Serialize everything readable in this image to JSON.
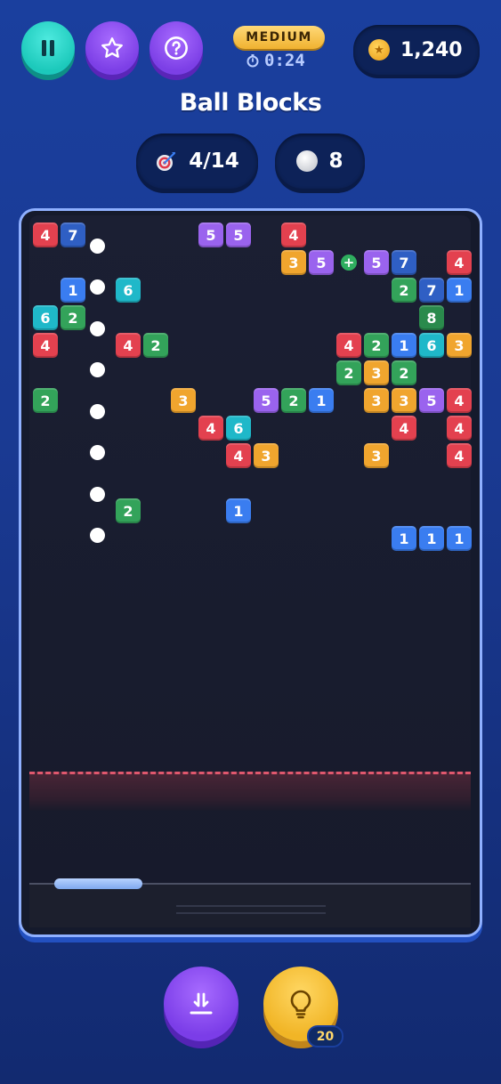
{
  "header": {
    "difficulty": "MEDIUM",
    "timer": "0:24",
    "coins": "1,240"
  },
  "title": "Ball Blocks",
  "stats": {
    "level": "4/14",
    "balls": "8"
  },
  "hint_count": "20",
  "icons": {
    "pause": "pause-icon",
    "star": "star-icon",
    "help": "question-icon",
    "stopwatch": "stopwatch-icon",
    "coin": "coin-icon",
    "target": "target-icon",
    "ball": "ball-icon",
    "drop": "drop-down-icon",
    "hint": "lightbulb-icon"
  },
  "colors": {
    "red": "#e3414f",
    "blue_dark": "#2f5fc4",
    "blue": "#3a7df0",
    "purple": "#9a63ee",
    "orange": "#f0a52e",
    "green": "#33a35a",
    "green_dark": "#2a8a4c",
    "cyan": "#1fb8c9",
    "accent_teal": "#1cc9bb",
    "accent_purple": "#7c3fe6",
    "accent_gold": "#f1b526"
  },
  "board": {
    "columns": 16,
    "blocks": [
      {
        "col": 0,
        "row": 0,
        "v": "4",
        "c": "red"
      },
      {
        "col": 1,
        "row": 0,
        "v": "7",
        "c": "blue_dark"
      },
      {
        "col": 6,
        "row": 0,
        "v": "5",
        "c": "purple"
      },
      {
        "col": 7,
        "row": 0,
        "v": "5",
        "c": "purple"
      },
      {
        "col": 9,
        "row": 0,
        "v": "4",
        "c": "red"
      },
      {
        "col": 9,
        "row": 1,
        "v": "3",
        "c": "orange"
      },
      {
        "col": 10,
        "row": 1,
        "v": "5",
        "c": "purple"
      },
      {
        "col": 12,
        "row": 1,
        "v": "5",
        "c": "purple"
      },
      {
        "col": 13,
        "row": 1,
        "v": "7",
        "c": "blue_dark"
      },
      {
        "col": 15,
        "row": 1,
        "v": "4",
        "c": "red"
      },
      {
        "col": 1,
        "row": 2,
        "v": "1",
        "c": "blue"
      },
      {
        "col": 3,
        "row": 2,
        "v": "6",
        "c": "cyan"
      },
      {
        "col": 13,
        "row": 2,
        "v": "2",
        "c": "green"
      },
      {
        "col": 14,
        "row": 2,
        "v": "7",
        "c": "blue_dark"
      },
      {
        "col": 15,
        "row": 2,
        "v": "1",
        "c": "blue"
      },
      {
        "col": 0,
        "row": 3,
        "v": "6",
        "c": "cyan"
      },
      {
        "col": 1,
        "row": 3,
        "v": "2",
        "c": "green"
      },
      {
        "col": 14,
        "row": 3,
        "v": "8",
        "c": "green_dark"
      },
      {
        "col": 0,
        "row": 4,
        "v": "4",
        "c": "red"
      },
      {
        "col": 3,
        "row": 4,
        "v": "4",
        "c": "red"
      },
      {
        "col": 4,
        "row": 4,
        "v": "2",
        "c": "green"
      },
      {
        "col": 11,
        "row": 4,
        "v": "4",
        "c": "red"
      },
      {
        "col": 12,
        "row": 4,
        "v": "2",
        "c": "green"
      },
      {
        "col": 13,
        "row": 4,
        "v": "1",
        "c": "blue"
      },
      {
        "col": 14,
        "row": 4,
        "v": "6",
        "c": "cyan"
      },
      {
        "col": 15,
        "row": 4,
        "v": "3",
        "c": "orange"
      },
      {
        "col": 11,
        "row": 5,
        "v": "2",
        "c": "green"
      },
      {
        "col": 12,
        "row": 5,
        "v": "3",
        "c": "orange"
      },
      {
        "col": 13,
        "row": 5,
        "v": "2",
        "c": "green"
      },
      {
        "col": 0,
        "row": 6,
        "v": "2",
        "c": "green"
      },
      {
        "col": 5,
        "row": 6,
        "v": "3",
        "c": "orange"
      },
      {
        "col": 8,
        "row": 6,
        "v": "5",
        "c": "purple"
      },
      {
        "col": 9,
        "row": 6,
        "v": "2",
        "c": "green"
      },
      {
        "col": 10,
        "row": 6,
        "v": "1",
        "c": "blue"
      },
      {
        "col": 12,
        "row": 6,
        "v": "3",
        "c": "orange"
      },
      {
        "col": 13,
        "row": 6,
        "v": "3",
        "c": "orange"
      },
      {
        "col": 14,
        "row": 6,
        "v": "5",
        "c": "purple"
      },
      {
        "col": 15,
        "row": 6,
        "v": "4",
        "c": "red"
      },
      {
        "col": 6,
        "row": 7,
        "v": "4",
        "c": "red"
      },
      {
        "col": 7,
        "row": 7,
        "v": "6",
        "c": "cyan"
      },
      {
        "col": 13,
        "row": 7,
        "v": "4",
        "c": "red"
      },
      {
        "col": 15,
        "row": 7,
        "v": "4",
        "c": "red"
      },
      {
        "col": 7,
        "row": 8,
        "v": "4",
        "c": "red"
      },
      {
        "col": 8,
        "row": 8,
        "v": "3",
        "c": "orange"
      },
      {
        "col": 12,
        "row": 8,
        "v": "3",
        "c": "orange"
      },
      {
        "col": 15,
        "row": 8,
        "v": "4",
        "c": "red"
      },
      {
        "col": 3,
        "row": 10,
        "v": "2",
        "c": "green"
      },
      {
        "col": 7,
        "row": 10,
        "v": "1",
        "c": "blue"
      },
      {
        "col": 13,
        "row": 11,
        "v": "1",
        "c": "blue"
      },
      {
        "col": 14,
        "row": 11,
        "v": "1",
        "c": "blue"
      },
      {
        "col": 15,
        "row": 11,
        "v": "1",
        "c": "blue"
      }
    ],
    "balls": [
      {
        "col": 2,
        "row": 0.5
      },
      {
        "col": 2,
        "row": 2
      },
      {
        "col": 2,
        "row": 3.5
      },
      {
        "col": 2,
        "row": 5
      },
      {
        "col": 2,
        "row": 6.5
      },
      {
        "col": 2,
        "row": 8
      },
      {
        "col": 2,
        "row": 9.5
      },
      {
        "col": 2,
        "row": 11
      }
    ],
    "powerups": [
      {
        "col": 11,
        "row": 1,
        "type": "extra-ball"
      }
    ]
  }
}
